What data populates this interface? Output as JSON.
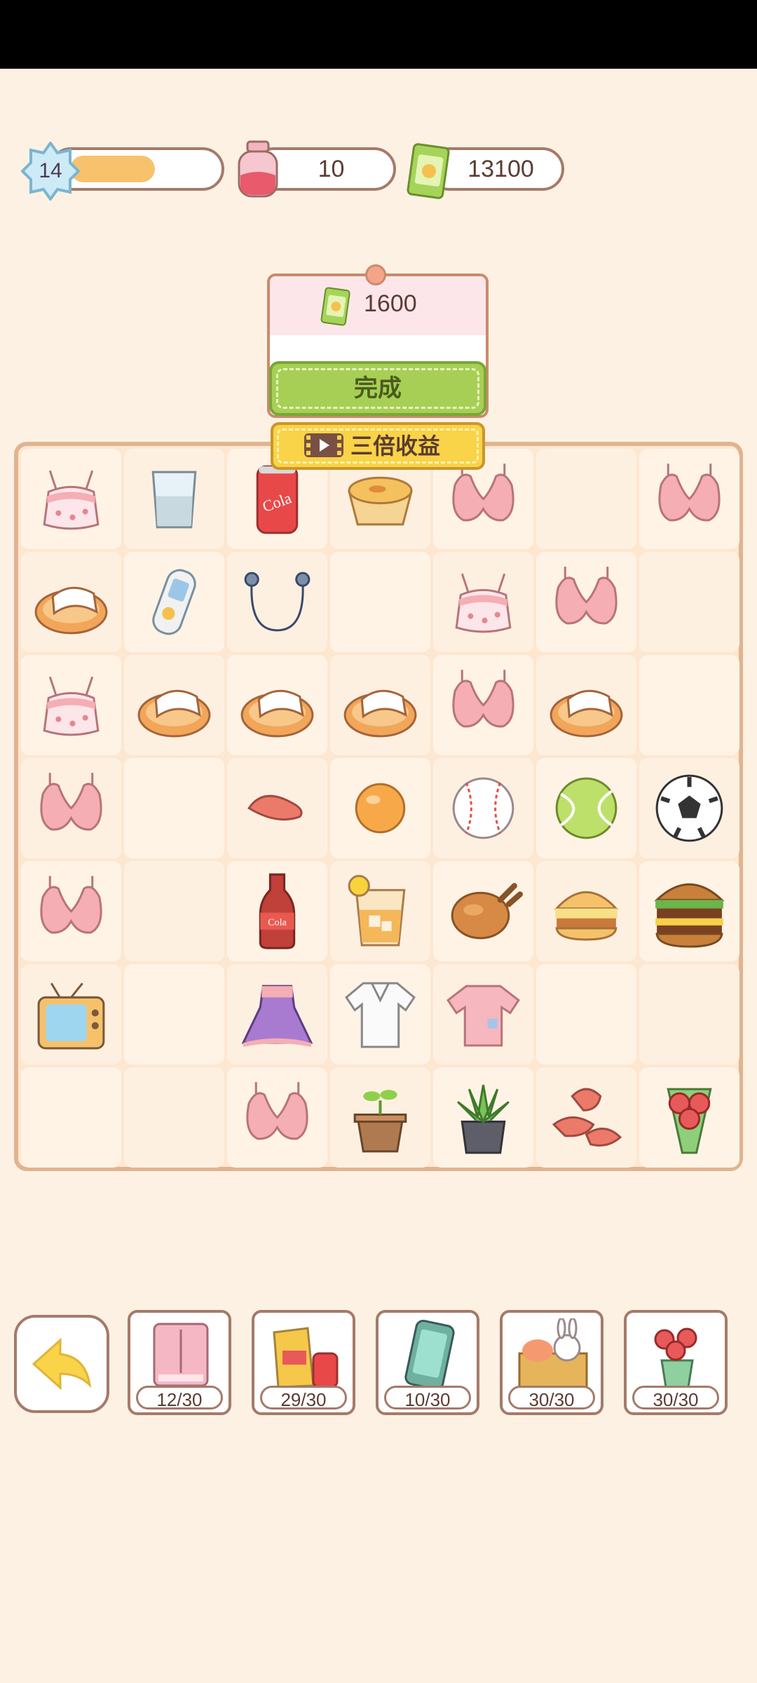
{
  "hud": {
    "level": "14",
    "level_progress": 0.55,
    "energy": "10",
    "cash": "13100"
  },
  "reward": {
    "amount": "1600",
    "done_label": "完成",
    "triple_label": "三倍收益"
  },
  "board": {
    "rows": [
      [
        "bra-skirt",
        "water-glass",
        "cola-can",
        "egg-tart",
        "bra",
        "",
        "bra"
      ],
      [
        "slipper",
        "mp3-player",
        "earphones",
        "",
        "bra-skirt",
        "bra",
        ""
      ],
      [
        "bra-skirt",
        "slipper",
        "slipper",
        "slipper",
        "bra",
        "slipper",
        ""
      ],
      [
        "bra",
        "",
        "sweet-potato",
        "ping-pong-ball",
        "baseball",
        "tennis-ball",
        "soccer-ball"
      ],
      [
        "bra",
        "",
        "cola-bottle",
        "iced-drink",
        "roast-chicken",
        "burger-small",
        "burger-big"
      ],
      [
        "tv",
        "",
        "purple-dress",
        "white-shirt",
        "pink-tshirt",
        "",
        ""
      ],
      [
        "",
        "",
        "bra",
        "sprout-pot",
        "succulent-pot",
        "sweet-potatoes",
        "rose-bouquet"
      ]
    ]
  },
  "collections": [
    {
      "icon": "wardrobe-icon",
      "count": "12/30"
    },
    {
      "icon": "snacks-icon",
      "count": "29/30"
    },
    {
      "icon": "phone-icon",
      "count": "10/30"
    },
    {
      "icon": "bunny-box-icon",
      "count": "30/30"
    },
    {
      "icon": "rose-vase-icon",
      "count": "30/30"
    }
  ]
}
